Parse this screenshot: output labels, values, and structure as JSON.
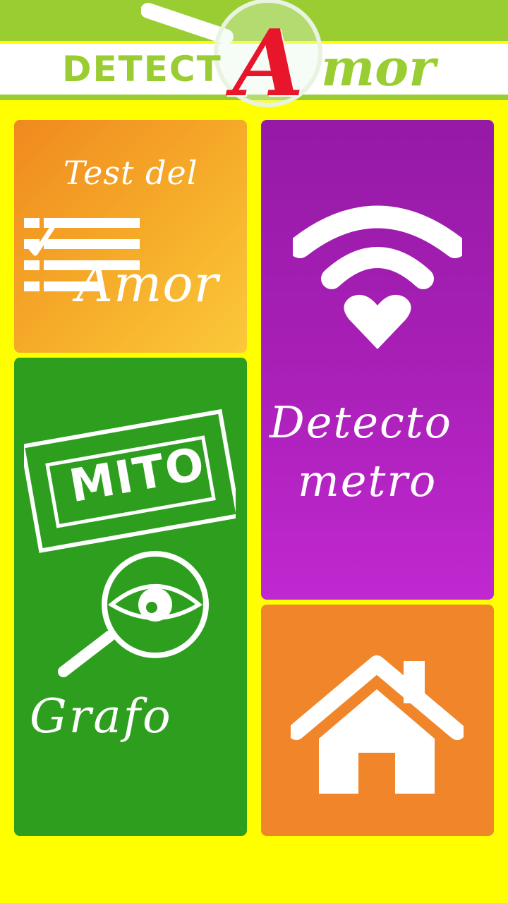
{
  "header": {
    "logo_word": "DETECT",
    "logo_letter": "A",
    "logo_tail": "mor",
    "colors": {
      "green": "#9acd32",
      "red": "#e8162a",
      "background": "#ffff00"
    }
  },
  "tiles": {
    "test": {
      "line1": "Test del",
      "line2": "Amor",
      "icon": "checklist-icon",
      "color": "#f6ad2a"
    },
    "mito": {
      "stamp": "MITO",
      "label": "Grafo",
      "icon": "eye-magnifier-icon",
      "color": "#2e9e1e"
    },
    "detecto": {
      "line1": "Detecto",
      "line2": "metro",
      "icon": "wifi-heart-icon",
      "color": "#a81fb6"
    },
    "home": {
      "icon": "home-icon",
      "color": "#f0852a"
    }
  }
}
